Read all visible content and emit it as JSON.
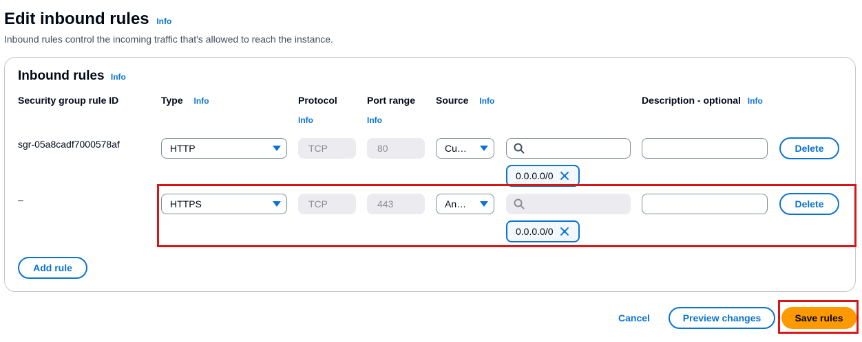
{
  "header": {
    "title": "Edit inbound rules",
    "info": "Info",
    "description": "Inbound rules control the incoming traffic that's allowed to reach the instance."
  },
  "panel": {
    "title": "Inbound rules",
    "info": "Info"
  },
  "columns": {
    "rule_id": "Security group rule ID",
    "type": "Type",
    "type_info": "Info",
    "protocol": "Protocol",
    "protocol_info": "Info",
    "port_range": "Port range",
    "port_range_info": "Info",
    "source": "Source",
    "source_info": "Info",
    "description": "Description - optional",
    "description_info": "Info"
  },
  "rules": [
    {
      "rule_id": "sgr-05a8cadf7000578af",
      "type": "HTTP",
      "protocol": "TCP",
      "port_range": "80",
      "source": "Cu…",
      "search_value": "",
      "cidr_token": "0.0.0.0/0",
      "description": "",
      "delete_label": "Delete"
    },
    {
      "rule_id": "–",
      "type": "HTTPS",
      "protocol": "TCP",
      "port_range": "443",
      "source": "An…",
      "search_value": "",
      "cidr_token": "0.0.0.0/0",
      "description": "",
      "delete_label": "Delete"
    }
  ],
  "add_rule_label": "Add rule",
  "footer": {
    "cancel": "Cancel",
    "preview": "Preview changes",
    "save": "Save rules"
  },
  "icons": {
    "search": "search-icon",
    "caret": "caret-down-icon",
    "remove": "close-icon"
  },
  "colors": {
    "link": "#0972d3",
    "primary": "#ff9900",
    "highlight": "#d91515",
    "disabled": "#ebebf0"
  }
}
